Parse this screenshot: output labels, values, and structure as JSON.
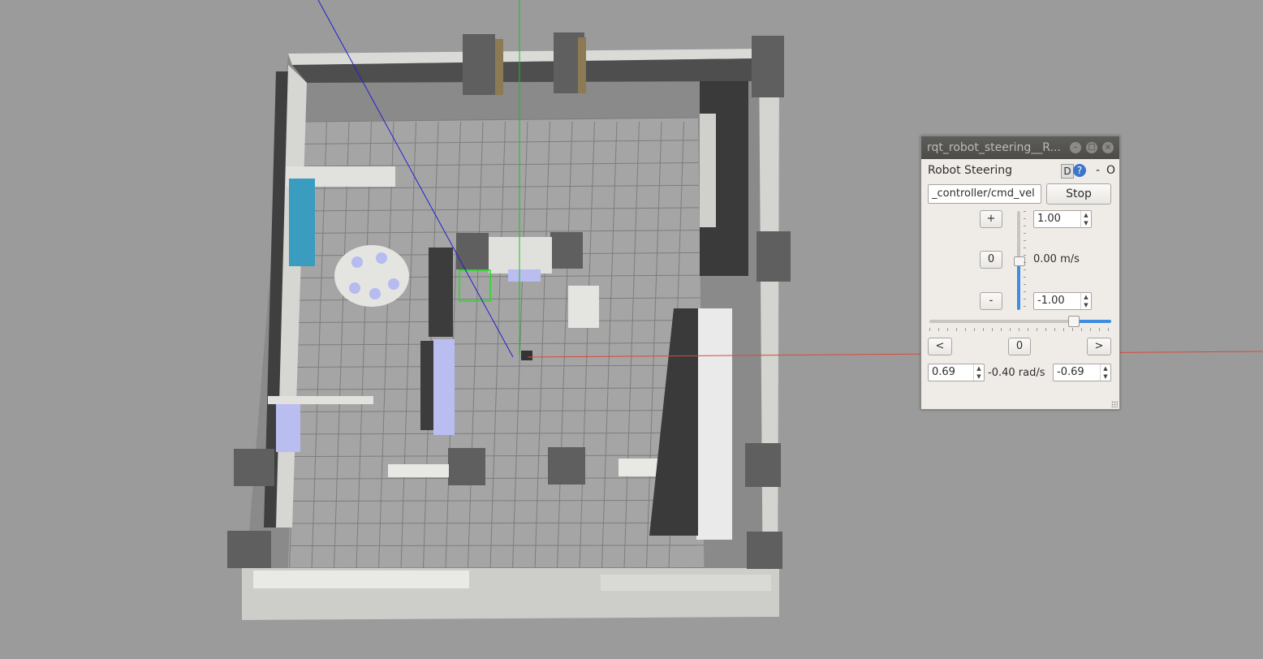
{
  "window": {
    "title": "rqt_robot_steering__R...",
    "plugin_title": "Robot Steering",
    "help_d": "D",
    "help_q": "?",
    "help_dash": "-",
    "help_o": "O",
    "controls": {
      "minimize": "–",
      "maximize": "□",
      "close": "×"
    }
  },
  "steering": {
    "topic_value": "_controller/cmd_vel",
    "stop_label": "Stop",
    "linear": {
      "plus_label": "+",
      "zero_label": "0",
      "minus_label": "-",
      "max_value": "1.00",
      "min_value": "-1.00",
      "current_label": "0.00 m/s",
      "slider_fraction": 0.5
    },
    "angular": {
      "left_label": "<",
      "zero_label": "0",
      "right_label": ">",
      "left_limit": "0.69",
      "right_limit": "-0.69",
      "current_label": "-0.40 rad/s",
      "slider_fraction": 0.79
    }
  },
  "colors": {
    "sky": "#9b9b9b",
    "floor": "#a5a5a5",
    "grid": "#7d7d7d",
    "wall": "#d9d9d6",
    "pillar": "#5c5c5c",
    "axis_x": "#d94a3a",
    "axis_y": "#1fbf1f",
    "axis_z": "#2020d0",
    "accent": "#3d8ee0"
  }
}
